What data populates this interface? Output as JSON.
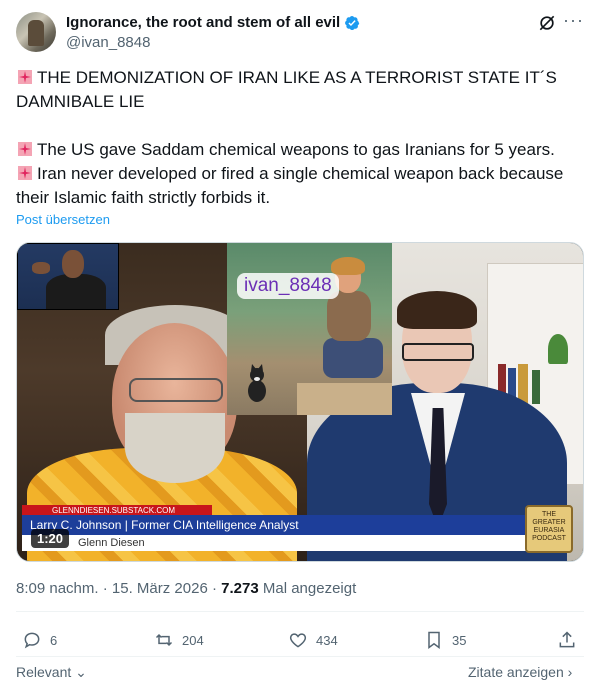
{
  "author": {
    "display_name": "Ignorance, the root and stem of all evil",
    "handle": "@ivan_8848",
    "verified": true
  },
  "tweet": {
    "line1": "THE DEMONIZATION OF IRAN LIKE AS A TERRORIST STATE IT´S DAMNIBALE LIE",
    "line2": "The US gave Saddam chemical weapons to gas Iranians for 5 years.",
    "line3": "Iran never developed or fired a single chemical weapon back because their Islamic faith strictly forbids it.",
    "translate_label": "Post übersetzen"
  },
  "video": {
    "watermark": "ivan_8848",
    "lower_third_small": "GLENNDIESEN.SUBSTACK.COM",
    "lower_third_title": "Larry C. Johnson | Former CIA Intelligence Analyst",
    "lower_third_sub": "Glenn Diesen",
    "logo_text": "THE GREATER EURASIA PODCAST",
    "duration": "1:20"
  },
  "meta": {
    "time": "8:09 nachm.",
    "date": "15. März 2026",
    "views_count": "7.273",
    "views_label": "Mal angezeigt"
  },
  "actions": {
    "replies": "6",
    "reposts": "204",
    "likes": "434",
    "bookmarks": "35"
  },
  "footer": {
    "sort_label": "Relevant",
    "quotes_label": "Zitate anzeigen"
  },
  "colors": {
    "accent": "#1d9bf0",
    "text": "#0f1419",
    "muted": "#536471",
    "siren": "#e0245e"
  }
}
